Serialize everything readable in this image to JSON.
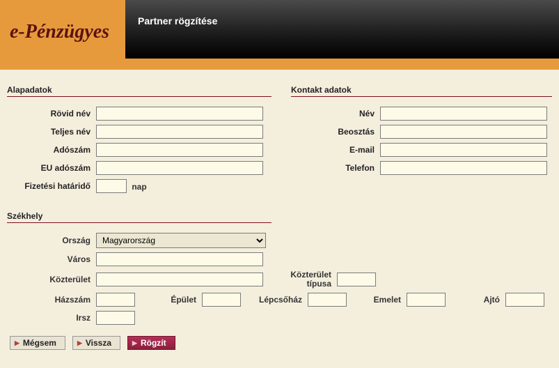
{
  "app": {
    "logo": "e-Pénzügyes",
    "title": "Partner rögzítése"
  },
  "sections": {
    "basic_title": "Alapadatok",
    "contact_title": "Kontakt adatok",
    "address_title": "Székhely"
  },
  "labels": {
    "short_name": "Rövid név",
    "full_name": "Teljes név",
    "tax_number": "Adószám",
    "eu_tax_number": "EU adószám",
    "payment_deadline": "Fizetési határidő",
    "payment_unit": "nap",
    "contact_name": "Név",
    "contact_position": "Beosztás",
    "contact_email": "E-mail",
    "contact_phone": "Telefon",
    "country": "Ország",
    "city": "Város",
    "street": "Közterület",
    "street_type": "Közterület típusa",
    "house_no": "Házszám",
    "building": "Épület",
    "staircase": "Lépcsőház",
    "floor": "Emelet",
    "door": "Ajtó",
    "zip": "Irsz"
  },
  "values": {
    "short_name": "",
    "full_name": "",
    "tax_number": "",
    "eu_tax_number": "",
    "payment_deadline": "",
    "contact_name": "",
    "contact_position": "",
    "contact_email": "",
    "contact_phone": "",
    "country": "Magyarország",
    "city": "",
    "street": "",
    "street_type": "",
    "house_no": "",
    "building": "",
    "staircase": "",
    "floor": "",
    "door": "",
    "zip": ""
  },
  "buttons": {
    "cancel": "Mégsem",
    "back": "Vissza",
    "save": "Rögzít"
  }
}
